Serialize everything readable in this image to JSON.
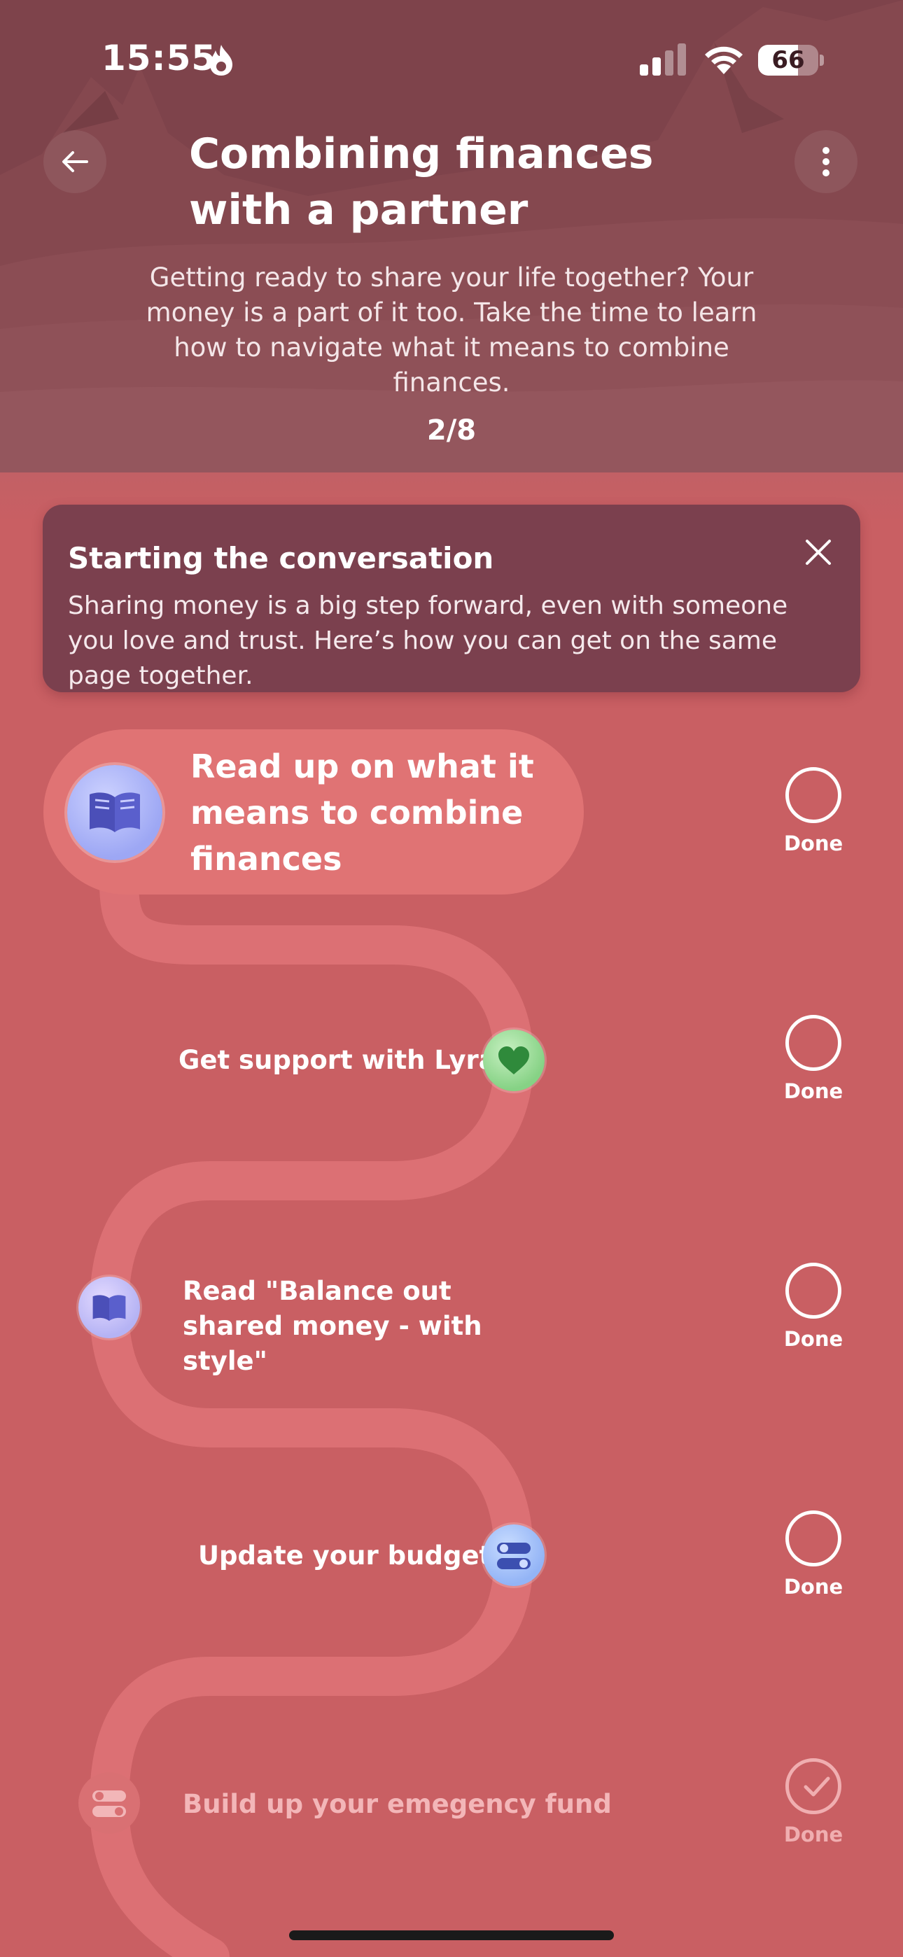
{
  "status_bar": {
    "time": "15:55",
    "battery": "66",
    "battery_fraction": 0.66,
    "icons": [
      "flame-icon",
      "cellular-signal-icon",
      "wifi-icon",
      "battery-icon"
    ]
  },
  "header": {
    "back_icon": "arrow-left-icon",
    "more_icon": "more-vertical-icon",
    "title": "Combining finances with a partner",
    "subtitle": "Getting ready to share your life together? Your money is a part of it too. Take the time to learn how to navigate what it means to combine finances.",
    "progress": "2/8"
  },
  "info_card": {
    "title": "Starting the conversation",
    "body": "Sharing money is a big step forward, even with someone you love and trust. Here’s how you can get on the same page together.",
    "close_icon": "close-icon"
  },
  "steps": [
    {
      "label": "Read up on what it means to combine finances",
      "icon": "book-icon",
      "done_label": "Done",
      "completed": false
    },
    {
      "label": "Get support with Lyra",
      "icon": "heart-icon",
      "done_label": "Done",
      "completed": false
    },
    {
      "label": "Read \"Balance out shared money - with style\"",
      "icon": "book-icon",
      "done_label": "Done",
      "completed": false
    },
    {
      "label": "Update your budget",
      "icon": "toggles-icon",
      "done_label": "Done",
      "completed": false
    },
    {
      "label": "Build up your emegency fund",
      "icon": "toggles-icon",
      "done_label": "Done",
      "completed": true
    }
  ],
  "colors": {
    "background": "#c95f63",
    "header": "#7e434b",
    "card": "#7b404e",
    "path": "#dc7074"
  }
}
